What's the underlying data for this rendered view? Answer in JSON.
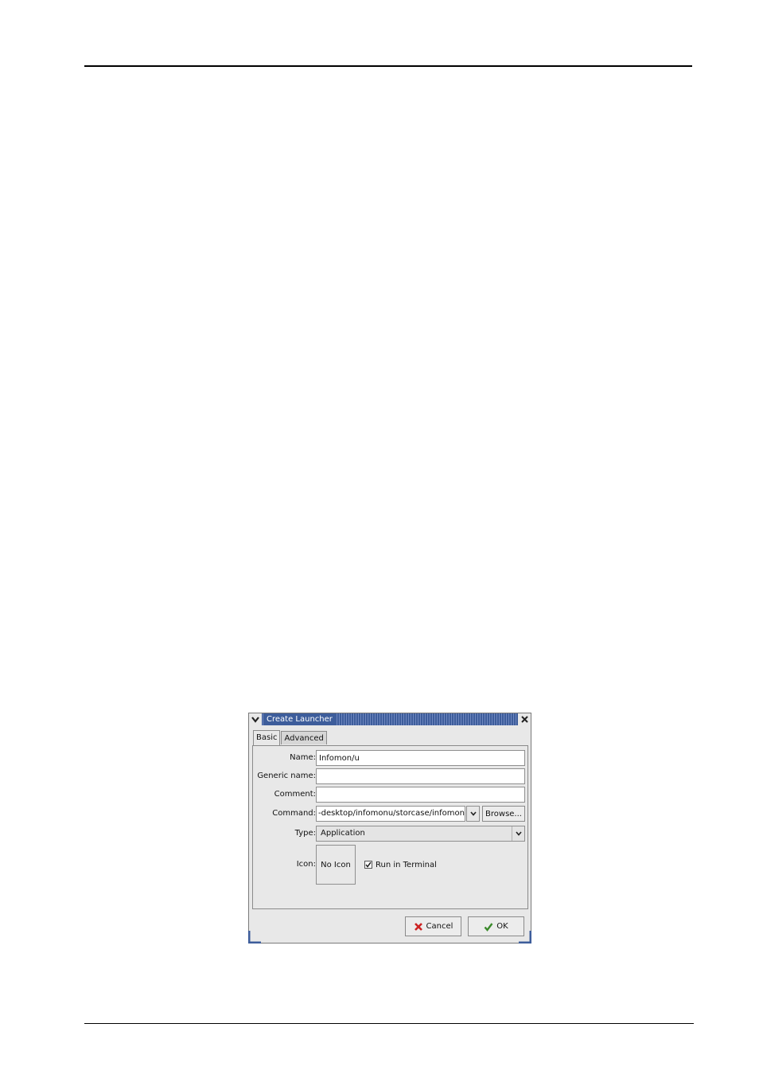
{
  "dialog": {
    "title": "Create Launcher",
    "tabs": [
      {
        "label": "Basic",
        "active": true
      },
      {
        "label": "Advanced",
        "active": false
      }
    ],
    "fields": {
      "name": {
        "label": "Name:",
        "value": "Infomon/u"
      },
      "generic_name": {
        "label": "Generic name:",
        "value": ""
      },
      "comment": {
        "label": "Comment:",
        "value": ""
      },
      "command": {
        "label": "Command:",
        "value": "-desktop/infomonu/storcase/infomonu"
      },
      "type": {
        "label": "Type:",
        "value": "Application"
      },
      "icon": {
        "label": "Icon:",
        "value": "No Icon"
      }
    },
    "browse_label": "Browse...",
    "run_in_terminal": {
      "label": "Run in Terminal",
      "checked": true
    },
    "buttons": {
      "cancel": "Cancel",
      "ok": "OK"
    }
  },
  "colors": {
    "titlebar": "#3d5d9b",
    "window_bg": "#e8e8e8",
    "cancel_icon": "#cc2222",
    "ok_icon": "#3a8a2a"
  },
  "icons": [
    "window-menu-icon",
    "close-icon",
    "chevron-down-icon",
    "cancel-x-icon",
    "ok-check-icon",
    "checkbox-check-icon"
  ]
}
